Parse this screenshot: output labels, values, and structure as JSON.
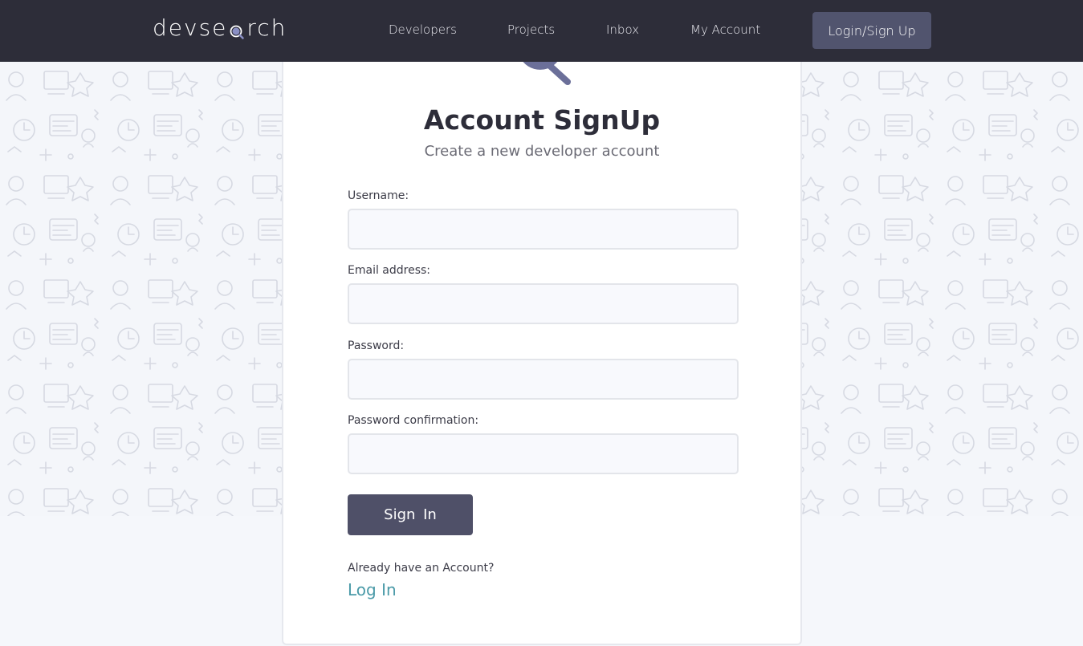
{
  "brand": {
    "logo_text_left": "devse",
    "logo_text_right": "rch"
  },
  "nav": {
    "links": [
      {
        "label": "Developers"
      },
      {
        "label": "Projects"
      },
      {
        "label": "Inbox"
      },
      {
        "label": "My Account"
      }
    ],
    "login_button": "Login/Sign Up"
  },
  "form": {
    "title": "Account SignUp",
    "subtitle": "Create a new developer account",
    "fields": [
      {
        "label": "Username:",
        "value": "",
        "type": "text"
      },
      {
        "label": "Email address:",
        "value": "",
        "type": "email"
      },
      {
        "label": "Password:",
        "value": "",
        "type": "password"
      },
      {
        "label": "Password confirmation:",
        "value": "",
        "type": "password"
      }
    ],
    "submit_label": "Sign  In",
    "already_text": "Already have an Account?",
    "login_link": "Log In"
  },
  "icons": {
    "logo_icon": "magnifier-icon",
    "card_icon": "magnifier-icon",
    "background": "doodle-pattern"
  },
  "colors": {
    "navbar": "#2d2d39",
    "button": "#51546e",
    "link": "#4a9aa8",
    "icon": "#6b6f99"
  }
}
